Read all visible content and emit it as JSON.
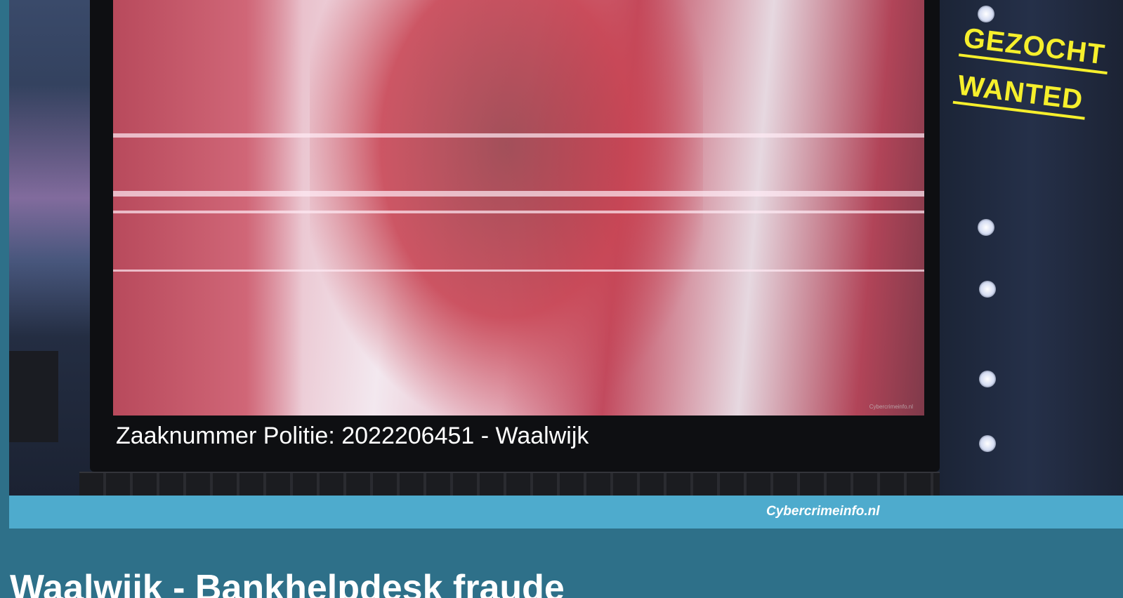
{
  "image": {
    "case_caption": "Zaaknummer Politie: 2022206451 - Waalwijk",
    "screen_watermark": "Cybercrimeinfo.nl",
    "stamp": {
      "line1": "GEZOCHT",
      "line2": "WANTED",
      "color": "#f6ef2c"
    }
  },
  "credit": {
    "text": "Cybercrimeinfo.nl",
    "bar_color": "#4eabcd"
  },
  "article": {
    "title": "Waalwijk - Bankhelpdesk fraude"
  },
  "colors": {
    "page_background": "#2e7089"
  }
}
